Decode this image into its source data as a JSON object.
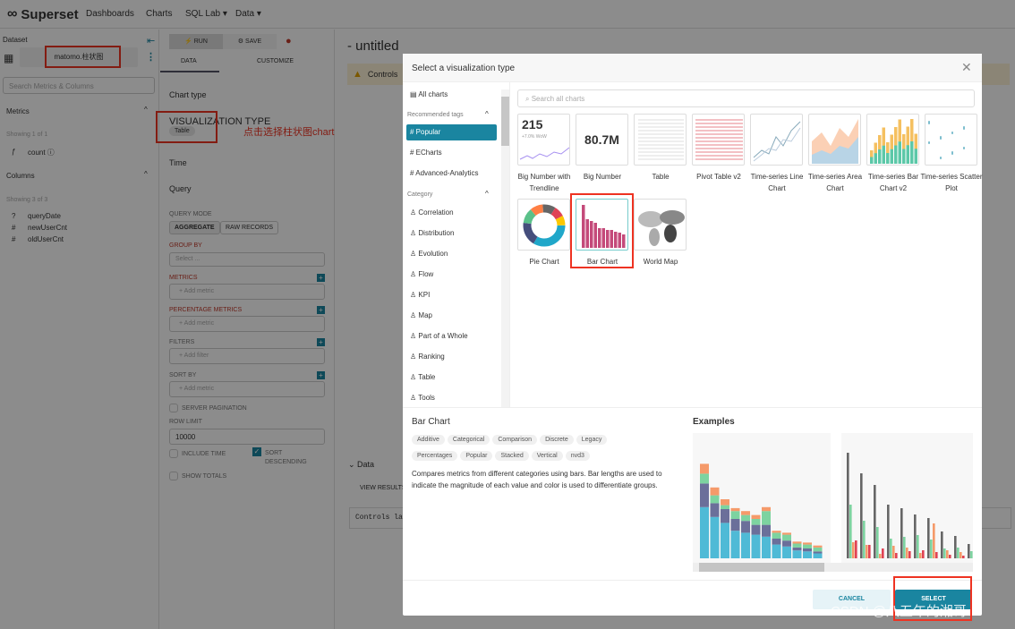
{
  "nav": {
    "brand": "Superset",
    "items": [
      "Dashboards",
      "Charts",
      "SQL Lab ▾",
      "Data ▾"
    ]
  },
  "dataset": {
    "label": "Dataset",
    "name": "matomo.柱状图",
    "search_placeholder": "Search Metrics & Columns",
    "metrics_title": "Metrics",
    "metrics_count": "Showing 1 of 1",
    "metrics": [
      {
        "icon": "ƒ",
        "name": "count ⓘ"
      }
    ],
    "columns_title": "Columns",
    "columns_count": "Showing 3 of 3",
    "columns": [
      {
        "icon": "?",
        "name": "queryDate"
      },
      {
        "icon": "#",
        "name": "newUserCnt"
      },
      {
        "icon": "#",
        "name": "oldUserCnt"
      }
    ]
  },
  "controls": {
    "run": "RUN",
    "save": "SAVE",
    "tab_data": "DATA",
    "tab_customize": "CUSTOMIZE",
    "chart_type": "Chart type",
    "viz_type_label": "VISUALIZATION TYPE",
    "viz_type_value": "Table",
    "time": "Time",
    "query": "Query",
    "query_mode": "QUERY MODE",
    "aggregate": "AGGREGATE",
    "raw_records": "RAW RECORDS",
    "group_by": "GROUP BY",
    "group_by_placeholder": "Select ...",
    "metrics": "METRICS",
    "add_metric": "+ Add metric",
    "percentage_metrics": "PERCENTAGE METRICS",
    "filters": "FILTERS",
    "add_filter": "+ Add filter",
    "sort_by": "SORT BY",
    "server_pagination": "SERVER PAGINATION",
    "row_limit": "ROW LIMIT",
    "row_limit_value": "10000",
    "include_time": "INCLUDE TIME",
    "sort_descending": "SORT DESCENDING",
    "show_totals": "SHOW TOTALS"
  },
  "annotation": "点击选择柱状图chart",
  "main": {
    "title": "- untitled",
    "warning": "Controls",
    "data_title": "Data",
    "view_results": "VIEW RESULTS",
    "controls_label": "Controls lab"
  },
  "modal": {
    "title": "Select a visualization type",
    "all_charts": "All charts",
    "recommended_tags": "Recommended tags",
    "tags": [
      "Popular",
      "ECharts",
      "Advanced-Analytics"
    ],
    "category_title": "Category",
    "categories": [
      "Correlation",
      "Distribution",
      "Evolution",
      "Flow",
      "KPI",
      "Map",
      "Part of a Whole",
      "Ranking",
      "Table",
      "Tools"
    ],
    "search_placeholder": "Search all charts",
    "charts": [
      "Big Number with Trendline",
      "Big Number",
      "Table",
      "Pivot Table v2",
      "Time-series Line Chart",
      "Time-series Area Chart",
      "Time-series Bar Chart v2",
      "Time-series Scatter Plot",
      "Pie Chart",
      "Bar Chart",
      "World Map"
    ],
    "big_number_thumb": "215",
    "big_number_sub": "+7.0% WoW",
    "big_number2_thumb": "80.7M",
    "selected": {
      "name": "Bar Chart",
      "tags": [
        "Additive",
        "Categorical",
        "Comparison",
        "Discrete",
        "Legacy",
        "Percentages",
        "Popular",
        "Stacked",
        "Vertical",
        "nvd3"
      ],
      "description": "Compares metrics from different categories using bars. Bar lengths are used to indicate the magnitude of each value and color is used to differentiate groups.",
      "examples_title": "Examples"
    },
    "cancel": "CANCEL",
    "select": "SELECT"
  },
  "watermark": "CSDN @八五年的湘哥",
  "colors": {
    "accent": "#1a85a0",
    "highlight": "#ee3322"
  }
}
